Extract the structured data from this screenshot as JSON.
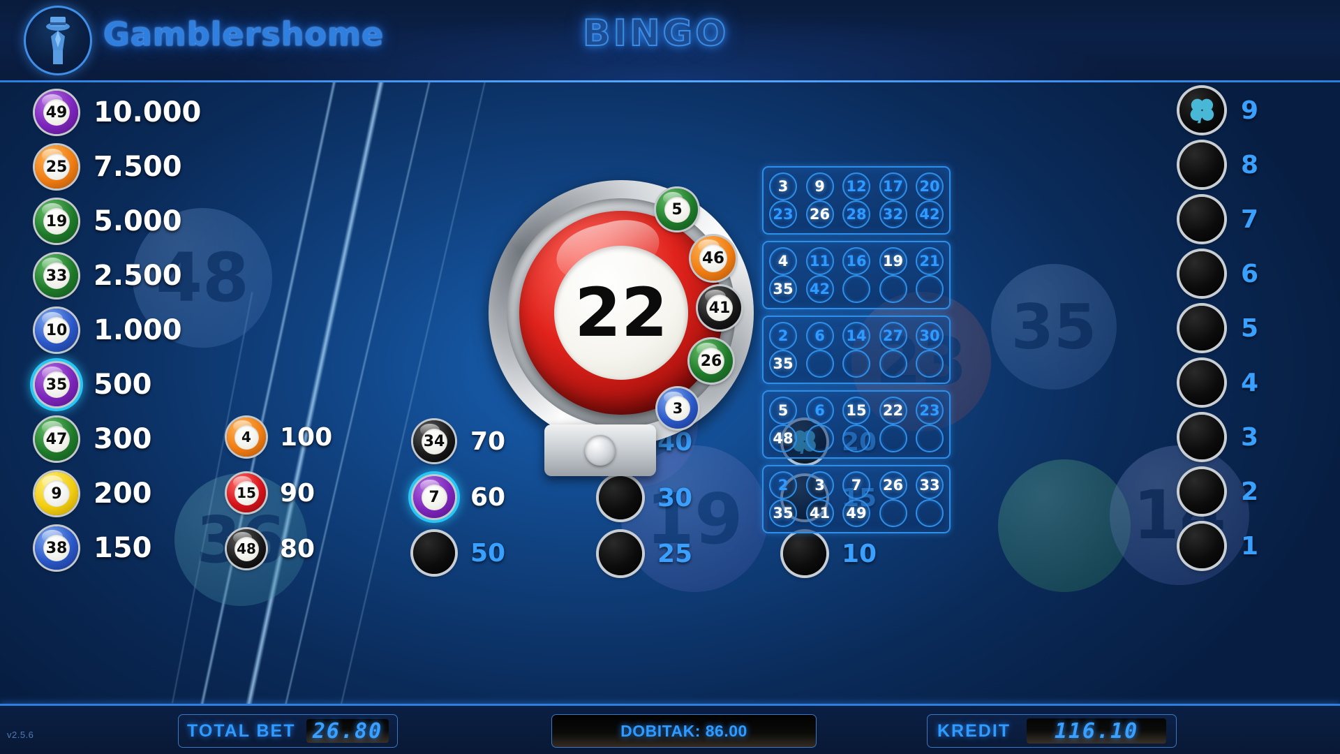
{
  "header": {
    "brand": "Gamblershome",
    "game_title": "BINGO",
    "logo_icon": "gentleman-tophat-icon"
  },
  "version": "v2.5.6",
  "drawn_ball": {
    "number": "22",
    "color": "#e0231c",
    "label": "current-drawn-ball"
  },
  "arc_balls": [
    {
      "number": "5",
      "color": "green"
    },
    {
      "number": "46",
      "color": "orange"
    },
    {
      "number": "41",
      "color": "black"
    },
    {
      "number": "26",
      "color": "green"
    },
    {
      "number": "3",
      "color": "blue"
    }
  ],
  "paytable_col1": [
    {
      "number": "49",
      "color": "purple",
      "payout": "10.000",
      "glow": false
    },
    {
      "number": "25",
      "color": "orange",
      "payout": "7.500",
      "glow": false
    },
    {
      "number": "19",
      "color": "green",
      "payout": "5.000",
      "glow": false
    },
    {
      "number": "33",
      "color": "green",
      "payout": "2.500",
      "glow": false
    },
    {
      "number": "10",
      "color": "blue",
      "payout": "1.000",
      "glow": false
    },
    {
      "number": "35",
      "color": "purple",
      "payout": "500",
      "glow": true
    },
    {
      "number": "47",
      "color": "green",
      "payout": "300",
      "glow": false
    },
    {
      "number": "9",
      "color": "yellow",
      "payout": "200",
      "glow": false
    },
    {
      "number": "38",
      "color": "blue",
      "payout": "150",
      "glow": false
    }
  ],
  "paytable_col2": [
    {
      "number": "4",
      "color": "orange",
      "payout": "100",
      "glow": false
    },
    {
      "number": "15",
      "color": "red",
      "payout": "90",
      "glow": false
    },
    {
      "number": "48",
      "color": "black",
      "payout": "80",
      "glow": false
    }
  ],
  "paytable_col3": [
    {
      "number": "34",
      "color": "black",
      "payout": "70",
      "glow": false,
      "blank": false
    },
    {
      "number": "7",
      "color": "purple",
      "payout": "60",
      "glow": true,
      "blank": false
    },
    {
      "number": "",
      "color": "black",
      "payout": "50",
      "glow": false,
      "blank": true
    }
  ],
  "paytable_col4": [
    {
      "number": "",
      "payout": "40",
      "blank": true,
      "clover": false
    },
    {
      "number": "",
      "payout": "30",
      "blank": true,
      "clover": false
    },
    {
      "number": "",
      "payout": "25",
      "blank": true,
      "clover": false
    }
  ],
  "paytable_col5": [
    {
      "number": "",
      "payout": "20",
      "blank": true,
      "clover": true
    },
    {
      "number": "",
      "payout": "15",
      "blank": true,
      "clover": false
    },
    {
      "number": "",
      "payout": "10",
      "blank": true,
      "clover": false
    }
  ],
  "paytable_col6": [
    {
      "number": "",
      "payout": "9",
      "blank": true,
      "clover": true
    },
    {
      "number": "",
      "payout": "8",
      "blank": true,
      "clover": false
    },
    {
      "number": "",
      "payout": "7",
      "blank": true,
      "clover": false
    },
    {
      "number": "",
      "payout": "6",
      "blank": true,
      "clover": false
    },
    {
      "number": "",
      "payout": "5",
      "blank": true,
      "clover": false
    },
    {
      "number": "",
      "payout": "4",
      "blank": true,
      "clover": false
    },
    {
      "number": "",
      "payout": "3",
      "blank": true,
      "clover": false
    },
    {
      "number": "",
      "payout": "2",
      "blank": true,
      "clover": false
    },
    {
      "number": "",
      "payout": "1",
      "blank": true,
      "clover": false
    }
  ],
  "cards": [
    {
      "id": 1,
      "rows": [
        [
          {
            "v": "3",
            "m": true
          },
          {
            "v": "9",
            "m": true
          },
          {
            "v": "12",
            "m": false
          },
          {
            "v": "17",
            "m": false
          },
          {
            "v": "20",
            "m": false
          }
        ],
        [
          {
            "v": "23",
            "m": false
          },
          {
            "v": "26",
            "m": true
          },
          {
            "v": "28",
            "m": false
          },
          {
            "v": "32",
            "m": false
          },
          {
            "v": "42",
            "m": false
          }
        ]
      ]
    },
    {
      "id": 2,
      "rows": [
        [
          {
            "v": "4",
            "m": true
          },
          {
            "v": "11",
            "m": false
          },
          {
            "v": "16",
            "m": false
          },
          {
            "v": "19",
            "m": true
          },
          {
            "v": "21",
            "m": false
          }
        ],
        [
          {
            "v": "35",
            "m": true
          },
          {
            "v": "42",
            "m": false
          },
          {
            "v": "",
            "m": false
          },
          {
            "v": "",
            "m": false
          },
          {
            "v": "",
            "m": false
          }
        ]
      ]
    },
    {
      "id": 3,
      "rows": [
        [
          {
            "v": "2",
            "m": false
          },
          {
            "v": "6",
            "m": false
          },
          {
            "v": "14",
            "m": false
          },
          {
            "v": "27",
            "m": false
          },
          {
            "v": "30",
            "m": false
          }
        ],
        [
          {
            "v": "35",
            "m": true
          },
          {
            "v": "",
            "m": false
          },
          {
            "v": "",
            "m": false
          },
          {
            "v": "",
            "m": false
          },
          {
            "v": "",
            "m": false
          }
        ]
      ]
    },
    {
      "id": 4,
      "rows": [
        [
          {
            "v": "5",
            "m": true
          },
          {
            "v": "6",
            "m": false
          },
          {
            "v": "15",
            "m": true
          },
          {
            "v": "22",
            "m": true
          },
          {
            "v": "23",
            "m": false
          }
        ],
        [
          {
            "v": "48",
            "m": true
          },
          {
            "v": "",
            "m": false
          },
          {
            "v": "",
            "m": false
          },
          {
            "v": "",
            "m": false
          },
          {
            "v": "",
            "m": false
          }
        ]
      ]
    },
    {
      "id": 5,
      "rows": [
        [
          {
            "v": "2",
            "m": false
          },
          {
            "v": "3",
            "m": true
          },
          {
            "v": "7",
            "m": true
          },
          {
            "v": "26",
            "m": true
          },
          {
            "v": "33",
            "m": true
          }
        ],
        [
          {
            "v": "35",
            "m": true
          },
          {
            "v": "41",
            "m": true
          },
          {
            "v": "49",
            "m": true
          },
          {
            "v": "",
            "m": false
          },
          {
            "v": "",
            "m": false
          }
        ]
      ]
    }
  ],
  "footer": {
    "total_bet_label": "TOTAL BET",
    "total_bet_value": "26.80",
    "dobitak_text": "DOBITAK: 86.00",
    "kredit_label": "KREDIT",
    "kredit_value": "116.10"
  },
  "colors": {
    "accent_blue": "#2f9bff",
    "panel_border": "#2f8fe8",
    "drawn_red": "#e0231c",
    "glow_cyan": "#27c6f5"
  }
}
